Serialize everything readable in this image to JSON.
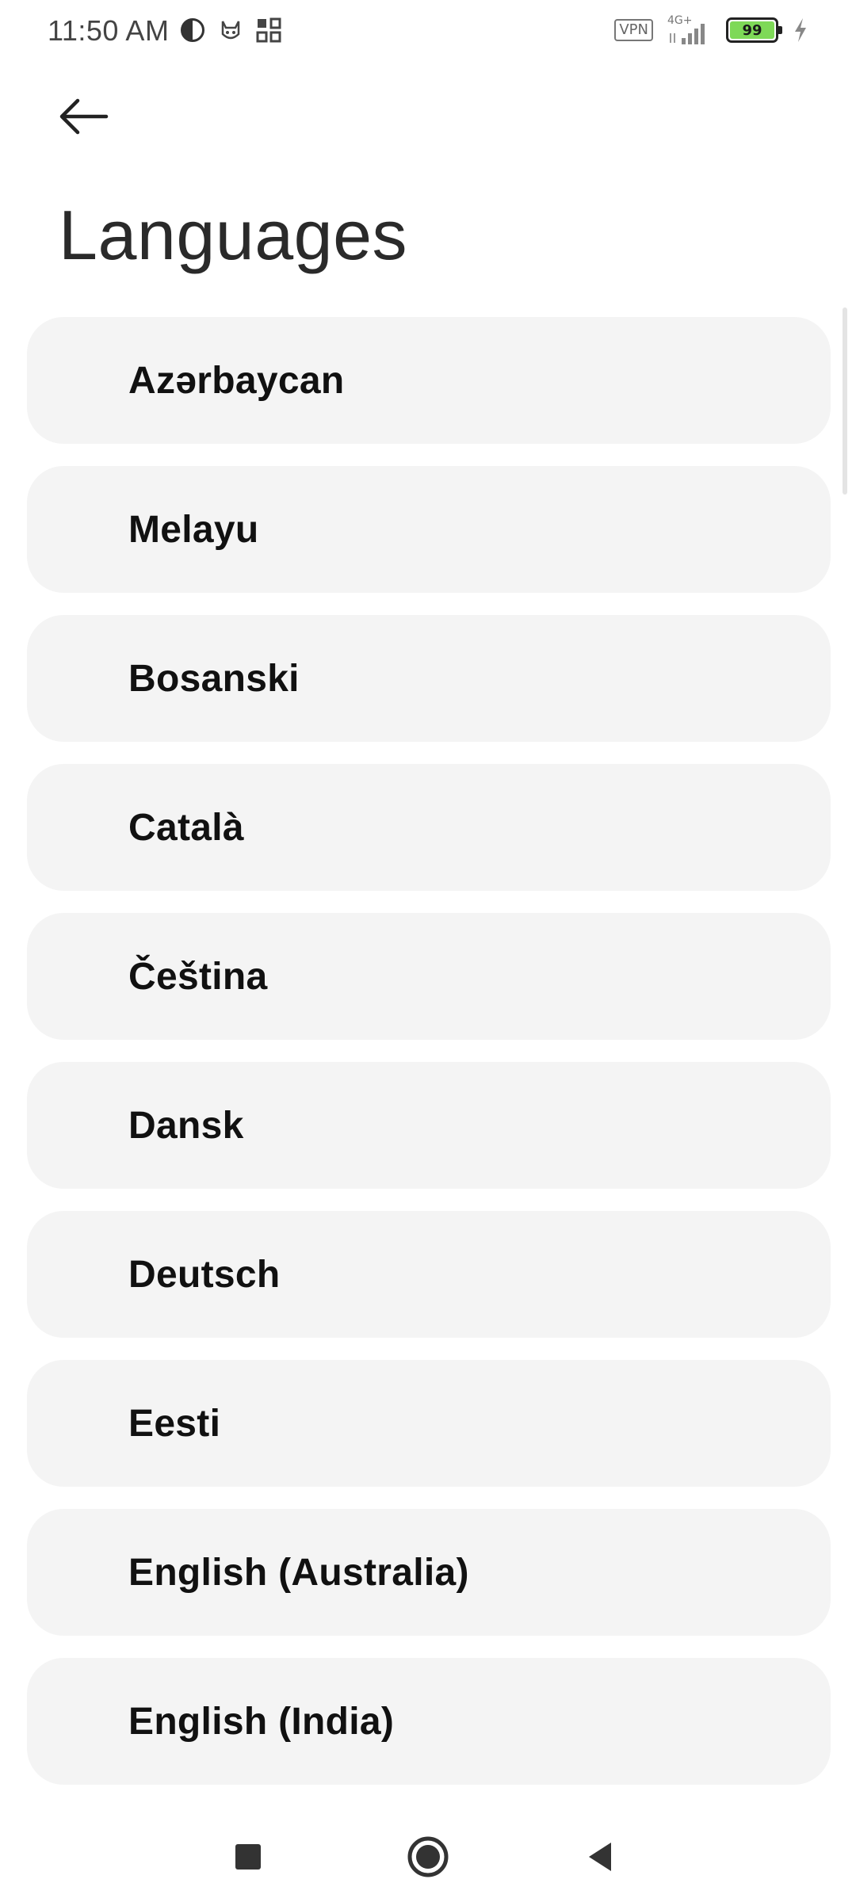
{
  "status_bar": {
    "time": "11:50 AM",
    "vpn_label": "VPN",
    "network_label": "4G+",
    "battery_level": "99",
    "icons": [
      "circle-half-icon",
      "cat-icon",
      "grid-icon",
      "signal-icon",
      "charging-icon"
    ]
  },
  "header": {
    "back_icon": "arrow-left-icon",
    "title": "Languages"
  },
  "languages": [
    {
      "label": "Azərbaycan"
    },
    {
      "label": "Melayu"
    },
    {
      "label": "Bosanski"
    },
    {
      "label": "Català"
    },
    {
      "label": "Čeština"
    },
    {
      "label": "Dansk"
    },
    {
      "label": "Deutsch"
    },
    {
      "label": "Eesti"
    },
    {
      "label": "English (Australia)"
    },
    {
      "label": "English (India)"
    }
  ],
  "nav_bar": {
    "icons": [
      "recents-square-icon",
      "home-circle-icon",
      "back-triangle-icon"
    ]
  },
  "colors": {
    "item_background": "#f4f4f4",
    "battery_fill": "#7ed957",
    "text": "#111111"
  }
}
